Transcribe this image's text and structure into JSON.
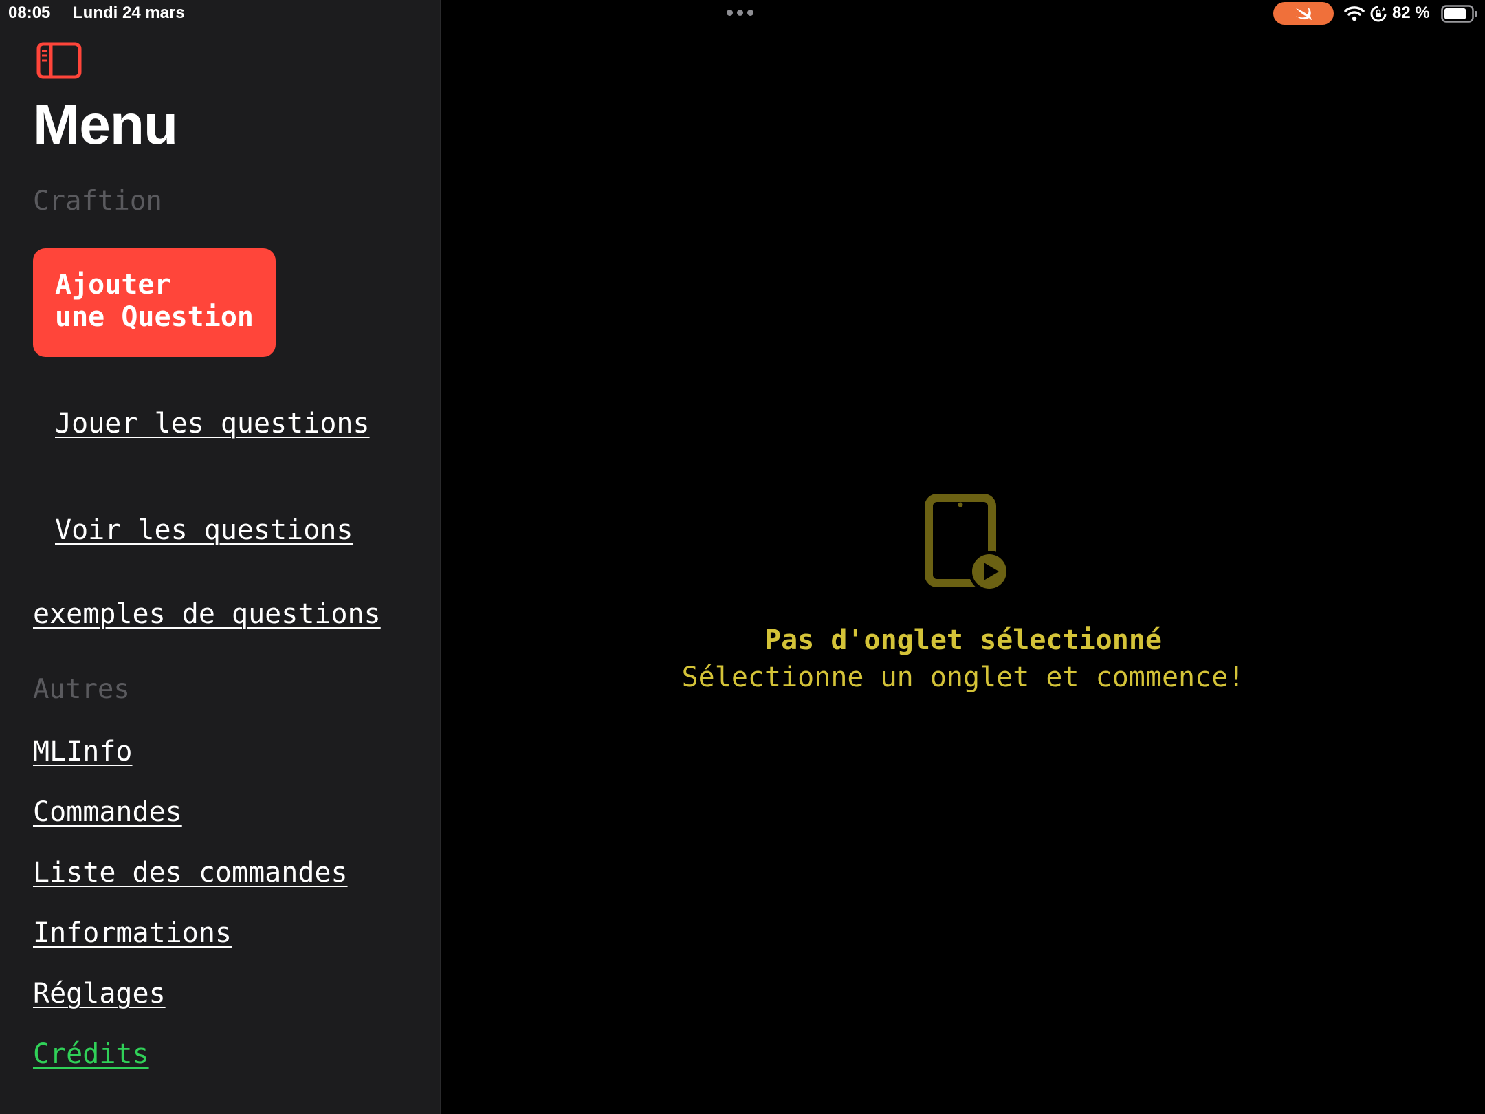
{
  "status_bar": {
    "time": "08:05",
    "date": "Lundi 24 mars",
    "battery_percent": "82 %",
    "battery_level": 0.82,
    "swift_indicator_color": "#f0703a"
  },
  "sidebar": {
    "title": "Menu",
    "sections": {
      "craftion": {
        "header": "Craftion",
        "add_button_line1": "Ajouter",
        "add_button_line2": "une Question",
        "play_link": "Jouer les questions",
        "view_link": "Voir les questions",
        "examples_link": "exemples de questions"
      },
      "autres": {
        "header": "Autres",
        "items": [
          {
            "label": "MLInfo"
          },
          {
            "label": "Commandes"
          },
          {
            "label": "Liste des commandes"
          },
          {
            "label": "Informations"
          },
          {
            "label": "Réglages"
          },
          {
            "label": "Crédits"
          }
        ]
      }
    }
  },
  "detail": {
    "empty_title": "Pas d'onglet sélectionné",
    "empty_subtitle": "Sélectionne un onglet et commence!",
    "icon": "ipad-play-icon"
  },
  "colors": {
    "accent": "#ff453a",
    "sidebar_bg": "#1c1c1e",
    "empty_text": "#d4c338",
    "empty_icon": "#6b6113",
    "credits": "#30d158"
  }
}
